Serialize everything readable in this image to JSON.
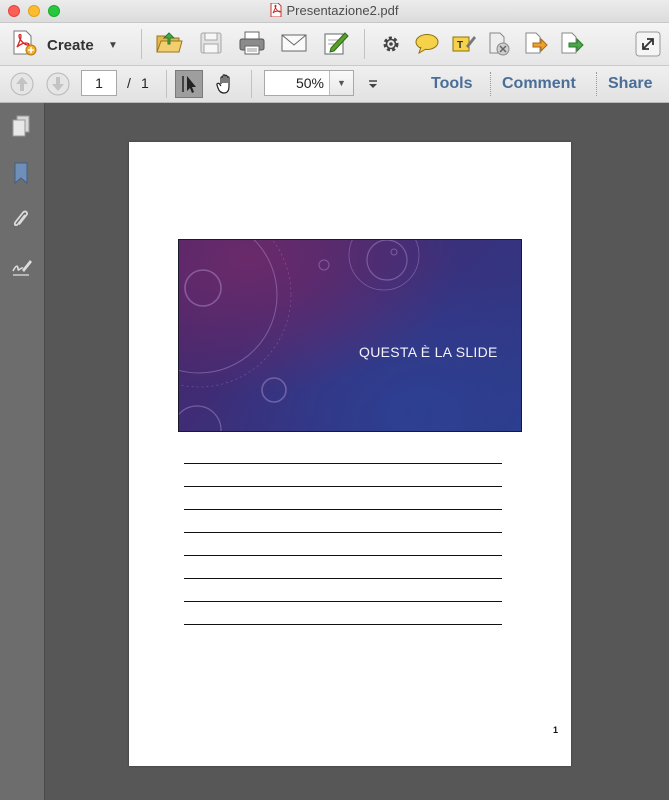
{
  "window": {
    "title": "Presentazione2.pdf"
  },
  "toolbar": {
    "create_label": "Create",
    "icons": [
      "open-file-icon",
      "save-icon",
      "print-icon",
      "email-icon",
      "sign-icon",
      "settings-icon",
      "comment-icon",
      "highlight-icon",
      "delete-page-icon",
      "export-icon",
      "send-icon",
      "fullscreen-icon"
    ]
  },
  "nav": {
    "current_page": "1",
    "page_separator": "/",
    "total_pages": "1",
    "zoom": "50%",
    "tools_label": "Tools",
    "comment_label": "Comment",
    "share_label": "Share"
  },
  "sidebar": {
    "icons": [
      "pages-icon",
      "bookmarks-icon",
      "attachments-icon",
      "signatures-icon"
    ]
  },
  "document": {
    "slide_title": "QUESTA È LA SLIDE",
    "page_number": "1",
    "note_line_count": 8
  }
}
